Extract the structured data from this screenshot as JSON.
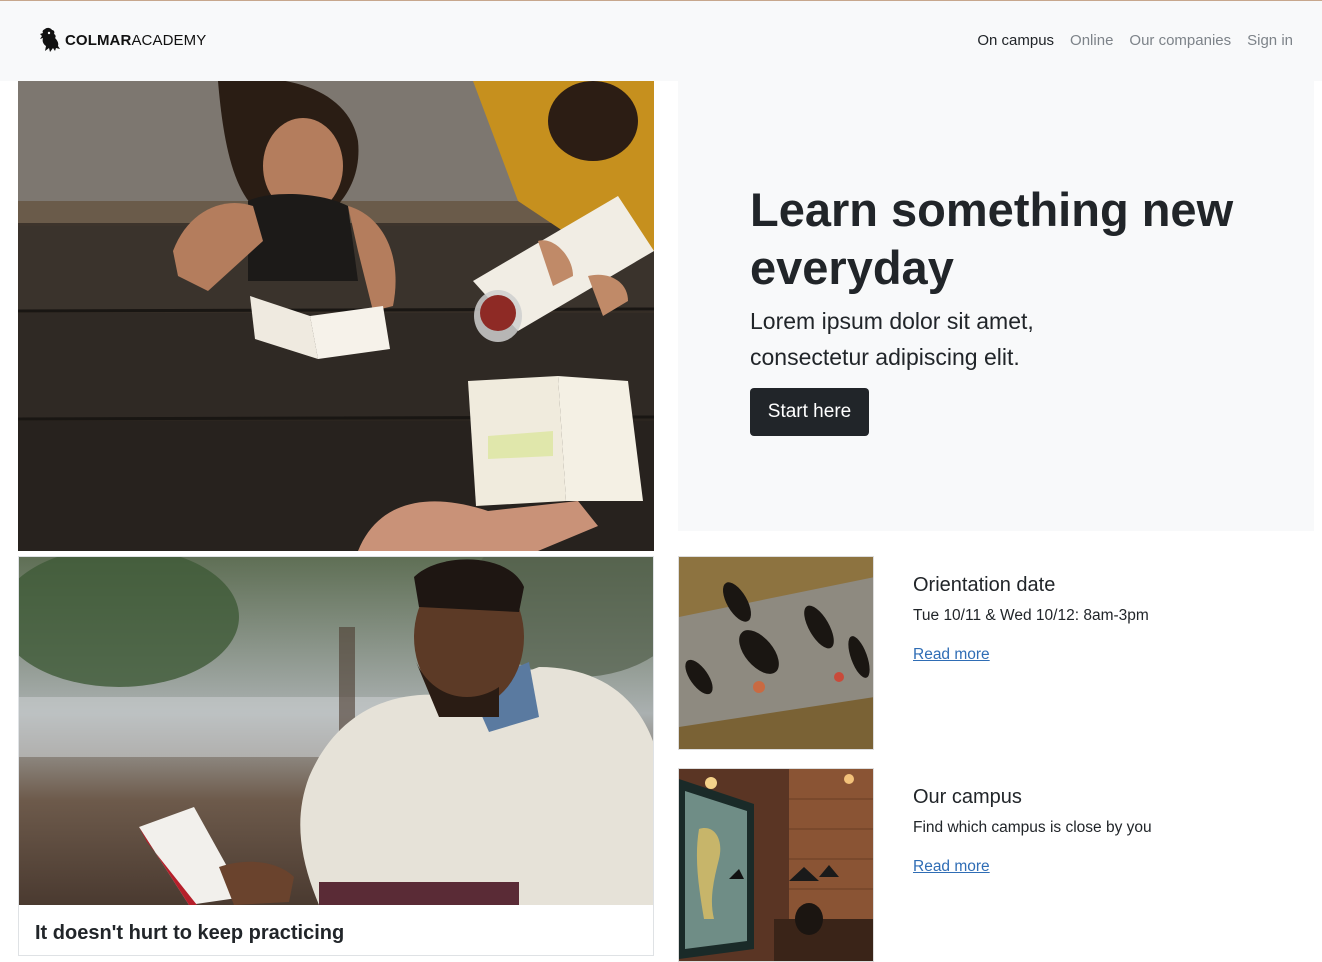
{
  "navbar": {
    "brand_bold": "COLMAR",
    "brand_light": "ACADEMY",
    "links": [
      {
        "label": "On campus",
        "active": true
      },
      {
        "label": "Online",
        "active": false
      },
      {
        "label": "Our companies",
        "active": false
      },
      {
        "label": "Sign in",
        "active": false
      }
    ]
  },
  "hero": {
    "title": "Learn something new everyday",
    "lead": "Lorem ipsum dolor sit amet, consectetur adipiscing elit.",
    "button_label": "Start here"
  },
  "card": {
    "title": "It doesn't hurt to keep practicing"
  },
  "items": [
    {
      "title": "Orientation date",
      "text": "Tue 10/11 & Wed 10/12: 8am-3pm",
      "link": "Read more"
    },
    {
      "title": "Our campus",
      "text": "Find which campus is close by you",
      "link": "Read more"
    }
  ],
  "colors": {
    "navbar_bg": "#f8f9fa",
    "button_bg": "#212529",
    "link": "#2f6db5"
  }
}
